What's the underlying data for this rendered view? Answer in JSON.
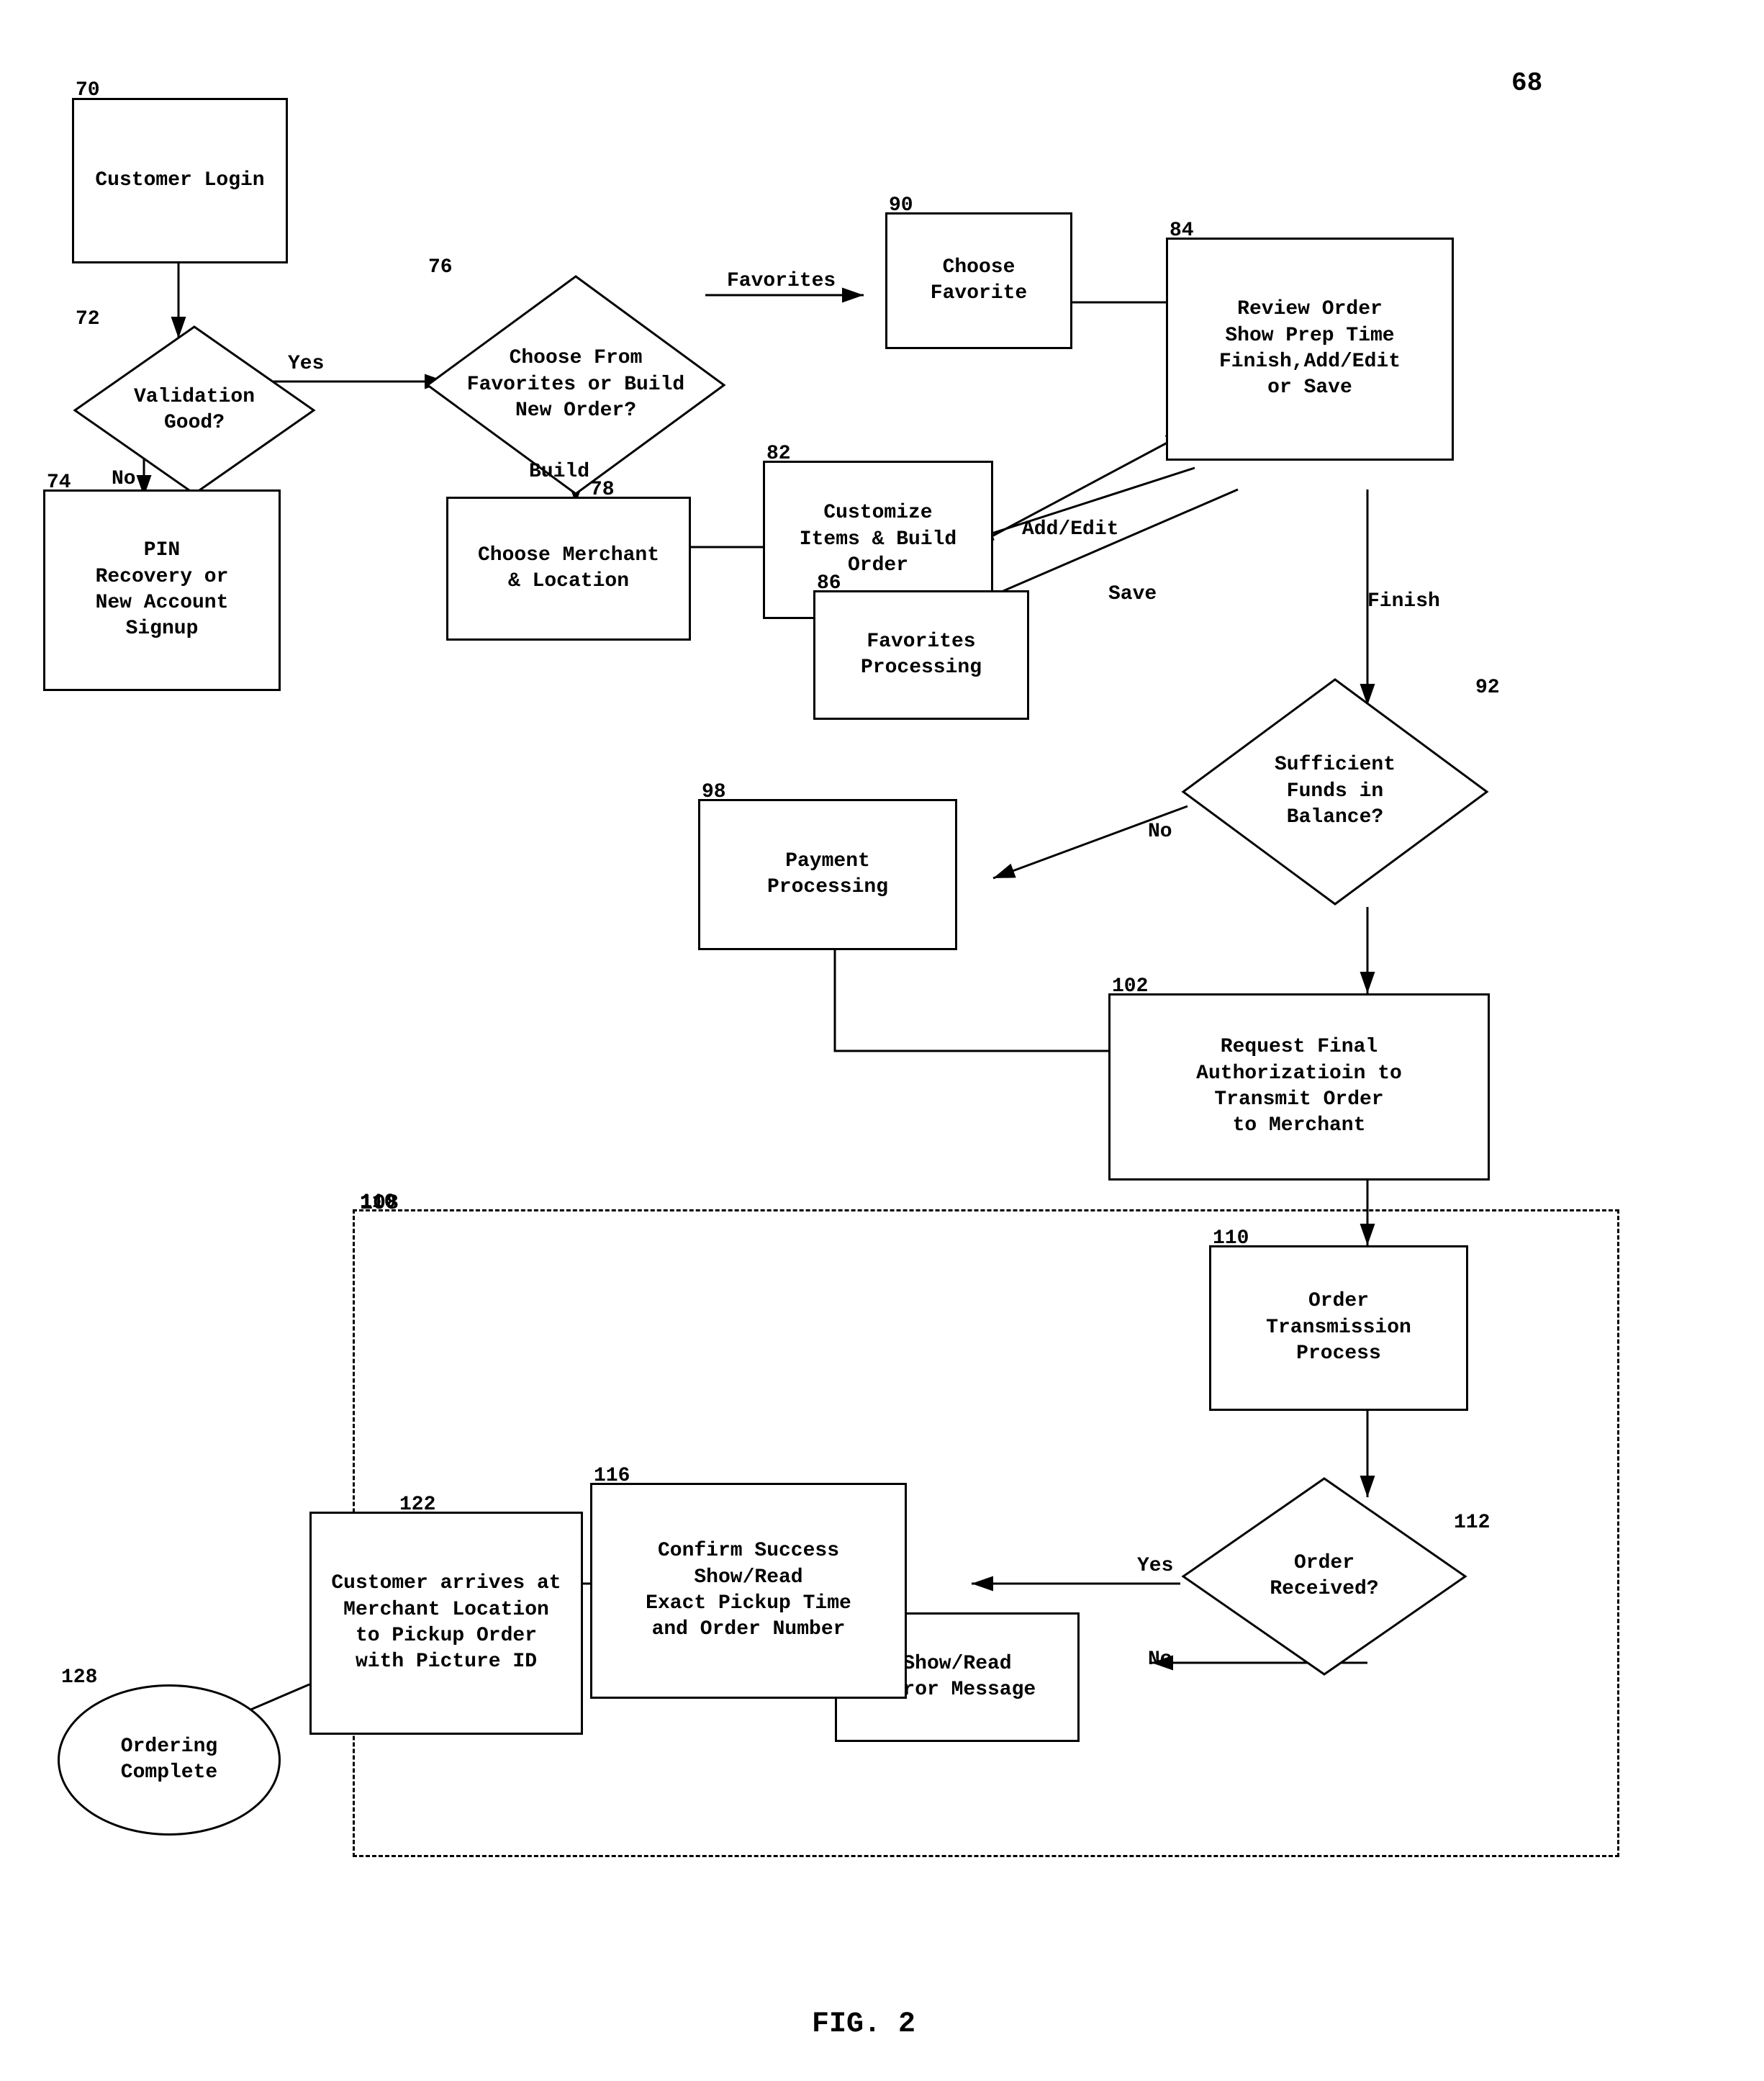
{
  "title": "FIG. 2",
  "nodes": {
    "customer_login": {
      "label": "Customer\nLogin",
      "id": "70",
      "type": "rect"
    },
    "validation": {
      "label": "Validation\nGood?",
      "id": "72",
      "type": "diamond"
    },
    "pin_recovery": {
      "label": "PIN\nRecovery or\nNew Account\nSignup",
      "id": "74",
      "type": "rect"
    },
    "favorites_or_build": {
      "label": "Choose From\nFavorites or Build\nNew Order?",
      "id": "76",
      "type": "diamond"
    },
    "choose_merchant": {
      "label": "Choose Merchant\n& Location",
      "id": "78",
      "type": "rect"
    },
    "customize_items": {
      "label": "Customize\nItems & Build\nOrder",
      "id": "82",
      "type": "rect"
    },
    "choose_favorite": {
      "label": "Choose\nFavorite",
      "id": "90",
      "type": "rect"
    },
    "review_order": {
      "label": "Review Order\nShow Prep Time\nFinish,Add/Edit\nor Save",
      "id": "84",
      "type": "rect"
    },
    "favorites_processing": {
      "label": "Favorites\nProcessing",
      "id": "86",
      "type": "rect"
    },
    "sufficient_funds": {
      "label": "Sufficient\nFunds in\nBalance?",
      "id": "92",
      "type": "diamond"
    },
    "payment_processing": {
      "label": "Payment\nProcessing",
      "id": "98",
      "type": "rect"
    },
    "request_final": {
      "label": "Request Final\nAuthorizatioin to\nTransmit Order\nto Merchant",
      "id": "102",
      "type": "rect"
    },
    "order_transmission": {
      "label": "Order\nTransmission\nProcess",
      "id": "110",
      "type": "rect"
    },
    "order_received": {
      "label": "Order\nReceived?",
      "id": "112",
      "type": "diamond"
    },
    "show_read_error": {
      "label": "Show/Read\nError Message",
      "id": "114",
      "type": "rect"
    },
    "confirm_success": {
      "label": "Confirm Success\nShow/Read\nExact Pickup Time\nand Order Number",
      "id": "116",
      "type": "rect"
    },
    "customer_arrives": {
      "label": "Customer arrives at\nMerchant Location\nto Pickup Order\nwith Picture ID",
      "id": "122",
      "type": "rect"
    },
    "ordering_complete": {
      "label": "Ordering\nComplete",
      "id": "128",
      "type": "oval"
    }
  },
  "labels": {
    "yes_validation": "Yes",
    "no_validation": "No",
    "favorites_arrow": "Favorites",
    "build_arrow": "Build",
    "add_edit_arrow": "Add/Edit",
    "save_arrow": "Save",
    "finish_arrow": "Finish",
    "no_funds": "No",
    "yes_received": "Yes",
    "no_received": "No",
    "ref68": "68"
  },
  "caption": "FIG. 2"
}
